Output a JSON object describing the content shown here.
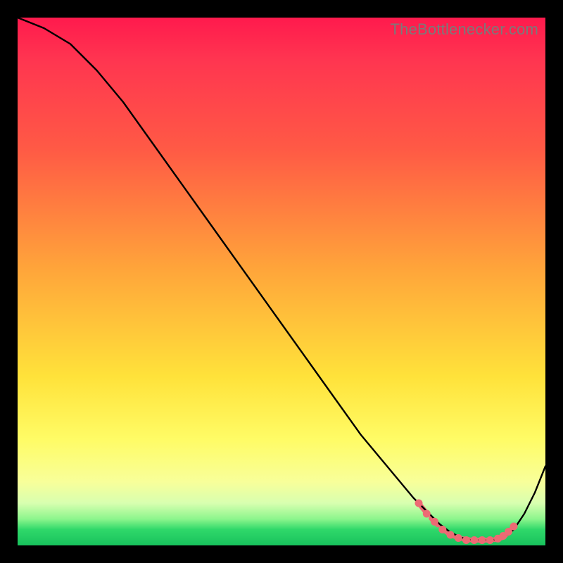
{
  "source_watermark": "TheBottlenecker.com",
  "chart_data": {
    "type": "line",
    "title": "",
    "xlabel": "",
    "ylabel": "",
    "xlim": [
      0,
      100
    ],
    "ylim": [
      0,
      100
    ],
    "grid": false,
    "legend": false,
    "background_gradient": {
      "direction": "vertical",
      "stops": [
        {
          "pos": 0,
          "color": "#ff1a4d"
        },
        {
          "pos": 25,
          "color": "#ff5a45"
        },
        {
          "pos": 50,
          "color": "#ffb43a"
        },
        {
          "pos": 75,
          "color": "#fff24d"
        },
        {
          "pos": 92,
          "color": "#d8ffb0"
        },
        {
          "pos": 100,
          "color": "#18c25c"
        }
      ]
    },
    "series": [
      {
        "name": "bottleneck-curve",
        "color": "#000000",
        "x": [
          0,
          5,
          10,
          15,
          20,
          25,
          30,
          35,
          40,
          45,
          50,
          55,
          60,
          65,
          70,
          75,
          78,
          80,
          82,
          84,
          86,
          88,
          90,
          92,
          94,
          96,
          98,
          100
        ],
        "y": [
          100,
          98,
          95,
          90,
          84,
          77,
          70,
          63,
          56,
          49,
          42,
          35,
          28,
          21,
          15,
          9,
          6,
          4,
          2.5,
          1.5,
          1,
          1,
          1,
          1.5,
          3,
          6,
          10,
          15
        ]
      },
      {
        "name": "highlighted-range",
        "color": "#ed6a74",
        "style": "dotted-thick",
        "x": [
          76,
          78,
          80,
          82,
          84,
          86,
          88,
          90,
          92,
          94
        ],
        "y": [
          8,
          5.5,
          3.5,
          2,
          1.3,
          1,
          1,
          1,
          1.5,
          3.5
        ]
      }
    ],
    "markers": [
      {
        "x": 76,
        "y": 8.0
      },
      {
        "x": 77.5,
        "y": 6.0
      },
      {
        "x": 79,
        "y": 4.5
      },
      {
        "x": 80.5,
        "y": 3.0
      },
      {
        "x": 82,
        "y": 2.0
      },
      {
        "x": 83.5,
        "y": 1.4
      },
      {
        "x": 85,
        "y": 1.0
      },
      {
        "x": 86.5,
        "y": 1.0
      },
      {
        "x": 88,
        "y": 1.0
      },
      {
        "x": 89.5,
        "y": 1.0
      },
      {
        "x": 91,
        "y": 1.3
      },
      {
        "x": 92,
        "y": 1.8
      },
      {
        "x": 93,
        "y": 2.6
      },
      {
        "x": 94,
        "y": 3.6
      }
    ]
  }
}
